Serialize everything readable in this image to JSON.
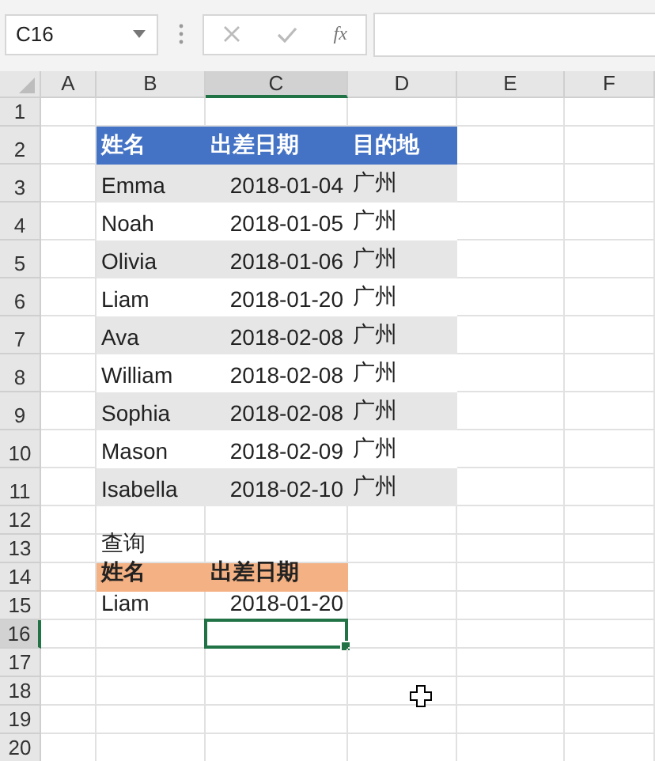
{
  "name_box": {
    "value": "C16"
  },
  "formula_bar": {
    "function_label": "fx"
  },
  "columns": [
    {
      "label": "A",
      "selected": false
    },
    {
      "label": "B",
      "selected": false
    },
    {
      "label": "C",
      "selected": true
    },
    {
      "label": "D",
      "selected": false
    },
    {
      "label": "E",
      "selected": false
    },
    {
      "label": "F",
      "selected": false
    }
  ],
  "rows": [
    {
      "number": "1",
      "selected": false,
      "kind": "blank",
      "cells": [
        null,
        null,
        null,
        null,
        null,
        null
      ]
    },
    {
      "number": "2",
      "selected": false,
      "kind": "header-blue",
      "cells": [
        null,
        "姓名",
        "出差日期",
        "目的地",
        null,
        null
      ]
    },
    {
      "number": "3",
      "selected": false,
      "kind": "band-grey",
      "cells": [
        null,
        "Emma",
        "2018-01-04",
        "广州",
        null,
        null
      ]
    },
    {
      "number": "4",
      "selected": false,
      "kind": "band-white",
      "cells": [
        null,
        "Noah",
        "2018-01-05",
        "广州",
        null,
        null
      ]
    },
    {
      "number": "5",
      "selected": false,
      "kind": "band-grey",
      "cells": [
        null,
        "Olivia",
        "2018-01-06",
        "广州",
        null,
        null
      ]
    },
    {
      "number": "6",
      "selected": false,
      "kind": "band-white",
      "cells": [
        null,
        "Liam",
        "2018-01-20",
        "广州",
        null,
        null
      ]
    },
    {
      "number": "7",
      "selected": false,
      "kind": "band-grey",
      "cells": [
        null,
        "Ava",
        "2018-02-08",
        "广州",
        null,
        null
      ]
    },
    {
      "number": "8",
      "selected": false,
      "kind": "band-white",
      "cells": [
        null,
        "William",
        "2018-02-08",
        "广州",
        null,
        null
      ]
    },
    {
      "number": "9",
      "selected": false,
      "kind": "band-grey",
      "cells": [
        null,
        "Sophia",
        "2018-02-08",
        "广州",
        null,
        null
      ]
    },
    {
      "number": "10",
      "selected": false,
      "kind": "band-white",
      "cells": [
        null,
        "Mason",
        "2018-02-09",
        "广州",
        null,
        null
      ]
    },
    {
      "number": "11",
      "selected": false,
      "kind": "band-grey",
      "cells": [
        null,
        "Isabella",
        "2018-02-10",
        "广州",
        null,
        null
      ]
    },
    {
      "number": "12",
      "selected": false,
      "kind": "blank",
      "cells": [
        null,
        null,
        null,
        null,
        null,
        null
      ]
    },
    {
      "number": "13",
      "selected": false,
      "kind": "blank",
      "cells": [
        null,
        "查询",
        null,
        null,
        null,
        null
      ]
    },
    {
      "number": "14",
      "selected": false,
      "kind": "header-orange",
      "cells": [
        null,
        "姓名",
        "出差日期",
        null,
        null,
        null
      ]
    },
    {
      "number": "15",
      "selected": false,
      "kind": "blank",
      "cells": [
        null,
        "Liam",
        "2018-01-20",
        null,
        null,
        null
      ]
    },
    {
      "number": "16",
      "selected": true,
      "kind": "blank",
      "cells": [
        null,
        null,
        null,
        null,
        null,
        null
      ]
    },
    {
      "number": "17",
      "selected": false,
      "kind": "blank",
      "cells": [
        null,
        null,
        null,
        null,
        null,
        null
      ]
    },
    {
      "number": "18",
      "selected": false,
      "kind": "blank",
      "cells": [
        null,
        null,
        null,
        null,
        null,
        null
      ]
    },
    {
      "number": "19",
      "selected": false,
      "kind": "blank",
      "cells": [
        null,
        null,
        null,
        null,
        null,
        null
      ]
    },
    {
      "number": "20",
      "selected": false,
      "kind": "blank",
      "cells": [
        null,
        null,
        null,
        null,
        null,
        null
      ]
    }
  ]
}
